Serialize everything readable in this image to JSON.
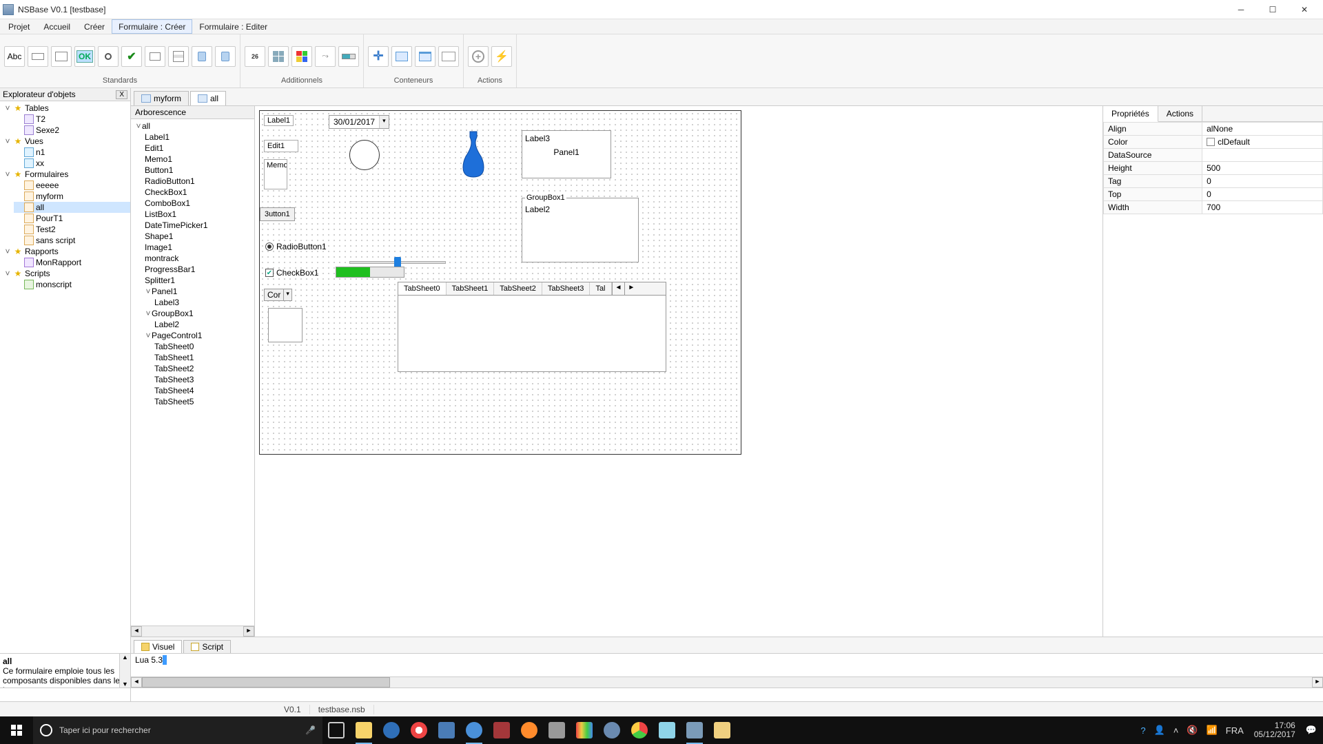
{
  "window": {
    "title": "NSBase V0.1 [testbase]"
  },
  "menu": {
    "items": [
      "Projet",
      "Accueil",
      "Créer",
      "Formulaire : Créer",
      "Formulaire : Editer"
    ],
    "active_index": 3
  },
  "ribbon": {
    "groups": {
      "standards": {
        "label": "Standards",
        "calendar_day": "26",
        "ok": "OK",
        "abc": "Abc"
      },
      "additionnels": {
        "label": "Additionnels"
      },
      "conteneurs": {
        "label": "Conteneurs"
      },
      "actions": {
        "label": "Actions"
      }
    }
  },
  "objexp": {
    "title": "Explorateur d'objets",
    "close": "X",
    "tables": {
      "label": "Tables",
      "items": [
        "T2",
        "Sexe2"
      ]
    },
    "vues": {
      "label": "Vues",
      "items": [
        "n1",
        "xx"
      ]
    },
    "formulaires": {
      "label": "Formulaires",
      "items": [
        "eeeee",
        "myform",
        "all",
        "PourT1",
        "Test2",
        "sans script"
      ],
      "selected": "all"
    },
    "rapports": {
      "label": "Rapports",
      "items": [
        "MonRapport"
      ]
    },
    "scripts": {
      "label": "Scripts",
      "items": [
        "monscript"
      ]
    }
  },
  "description": {
    "title": "all",
    "body": "Ce formulaire emploie tous les composants disponibles dans le but"
  },
  "formtabs": {
    "tabs": [
      "myform",
      "all"
    ],
    "active_index": 1
  },
  "arbo": {
    "title": "Arborescence",
    "root": "all",
    "items": [
      "Label1",
      "Edit1",
      "Memo1",
      "Button1",
      "RadioButton1",
      "CheckBox1",
      "ComboBox1",
      "ListBox1",
      "DateTimePicker1",
      "Shape1",
      "Image1",
      "montrack",
      "ProgressBar1",
      "Splitter1"
    ],
    "panel1": {
      "label": "Panel1",
      "items": [
        "Label3"
      ]
    },
    "groupbox1": {
      "label": "GroupBox1",
      "items": [
        "Label2"
      ]
    },
    "pagecontrol1": {
      "label": "PageControl1",
      "items": [
        "TabSheet0",
        "TabSheet1",
        "TabSheet2",
        "TabSheet3",
        "TabSheet4",
        "TabSheet5"
      ]
    }
  },
  "design": {
    "label1": "Label1",
    "edit1": "Edit1",
    "memo1": "Memo",
    "button1": "3utton1",
    "radio1": "RadioButton1",
    "check1": "CheckBox1",
    "combo1": "Cor",
    "date1": "30/01/2017",
    "label3": "Label3",
    "panel1": "Panel1",
    "groupbox1": "GroupBox1",
    "label2": "Label2",
    "tabs": [
      "TabSheet0",
      "TabSheet1",
      "TabSheet2",
      "TabSheet3",
      "Tal"
    ],
    "tab_active": 0
  },
  "props": {
    "tabs": [
      "Propriétés",
      "Actions"
    ],
    "active": 0,
    "rows": {
      "Align": "alNone",
      "Color": "clDefault",
      "DataSource": "",
      "Height": "500",
      "Tag": "0",
      "Top": "0",
      "Width": "700"
    }
  },
  "bottomtabs": {
    "tabs": [
      "Visuel",
      "Script"
    ],
    "active": 0
  },
  "console": {
    "output": "Lua 5.3"
  },
  "status": {
    "version": "V0.1",
    "file": "testbase.nsb"
  },
  "taskbar": {
    "search_placeholder": "Taper ici pour rechercher",
    "lang": "FRA",
    "time": "17:06",
    "date": "05/12/2017"
  }
}
